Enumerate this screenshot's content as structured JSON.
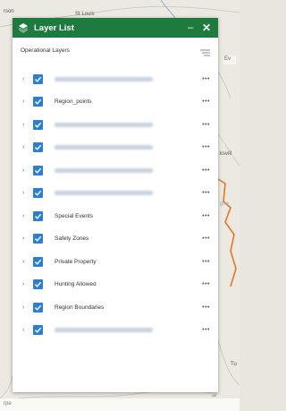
{
  "map": {
    "labels": [
      "rson",
      "St Louis",
      "Ev",
      "ksvill",
      "Tu",
      "gne"
    ],
    "attribution": "rpe"
  },
  "panel": {
    "title": "Layer List",
    "minimize_glyph": "–",
    "close_glyph": "✕",
    "section_title": "Operational Layers",
    "filter_icon": "filter-icon",
    "more_glyph": "•••",
    "expand_glyph": "›"
  },
  "layers": [
    {
      "label": "",
      "blurred": true,
      "checked": true
    },
    {
      "label": "Region_points",
      "blurred": false,
      "checked": true
    },
    {
      "label": "",
      "blurred": true,
      "checked": true
    },
    {
      "label": "",
      "blurred": true,
      "checked": true
    },
    {
      "label": "",
      "blurred": true,
      "checked": true
    },
    {
      "label": "",
      "blurred": true,
      "checked": true
    },
    {
      "label": "Special Events",
      "blurred": false,
      "checked": true
    },
    {
      "label": "Safety Zones",
      "blurred": false,
      "checked": true
    },
    {
      "label": "Private Property",
      "blurred": false,
      "checked": true
    },
    {
      "label": "Hunting Allowed",
      "blurred": false,
      "checked": true
    },
    {
      "label": "Region Boundaries",
      "blurred": false,
      "checked": true
    },
    {
      "label": "",
      "blurred": true,
      "checked": true
    }
  ],
  "colors": {
    "header": "#1e7b3e",
    "checkbox": "#2b7ed8",
    "route": "#e8761e"
  }
}
